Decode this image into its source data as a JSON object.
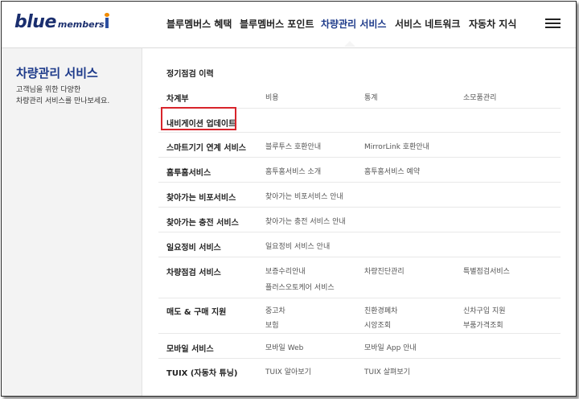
{
  "header": {
    "logo_blue": "blue",
    "logo_members": "members",
    "nav": [
      {
        "label": "블루멤버스 혜택"
      },
      {
        "label": "블루멤버스 포인트"
      },
      {
        "label": "차량관리 서비스"
      },
      {
        "label": "서비스 네트워크"
      },
      {
        "label": "자동차 지식"
      }
    ],
    "active_index": 2,
    "menu_icon": "hamburger-menu-icon"
  },
  "sidebar": {
    "title": "차량관리 서비스",
    "desc_line1": "고객님을 위한 다양한",
    "desc_line2": "차량관리 서비스를 만나보세요."
  },
  "content": {
    "rows": [
      {
        "category": "정기점검 이력",
        "links": []
      },
      {
        "category": "차계부",
        "links": [
          "비용",
          "통계",
          "소모품관리"
        ]
      },
      {
        "category": "내비게이션 업데이트",
        "links": [],
        "highlighted": true
      },
      {
        "category": "스마트기기 연계 서비스",
        "links": [
          "블루투스 호환안내",
          "MirrorLink 호환안내"
        ]
      },
      {
        "category": "홈투홈서비스",
        "links": [
          "홈투홈서비스 소개",
          "홈투홈서비스 예약"
        ]
      },
      {
        "category": "찾아가는 비포서비스",
        "links": [
          "찾아가는 비포서비스 안내"
        ]
      },
      {
        "category": "찾아가는 충전 서비스",
        "links": [
          "찾아가는 충전 서비스 안내"
        ]
      },
      {
        "category": "일요정비 서비스",
        "links": [
          "일요정비 서비스 안내"
        ]
      },
      {
        "category": "차량점검 서비스",
        "links": [
          "보증수리안내",
          "차량진단관리",
          "특별점검서비스",
          "플러스오토케어 서비스"
        ]
      },
      {
        "category": "매도 & 구매 지원",
        "links": [
          "중고차",
          "친환경폐차",
          "신차구입 지원",
          "보험",
          "시앙조회",
          "부품가격조회"
        ]
      },
      {
        "category": "모바일 서비스",
        "links": [
          "모바일 Web",
          "모바일 App 안내"
        ]
      },
      {
        "category": "TUIX (자동차 튜닝)",
        "links": [
          "TUIX 알아보기",
          "TUIX 살펴보기"
        ]
      }
    ]
  },
  "colors": {
    "brand_navy": "#1d3a8a",
    "highlight_red": "#d8242b",
    "sidebar_bg": "#f3f3f3"
  }
}
